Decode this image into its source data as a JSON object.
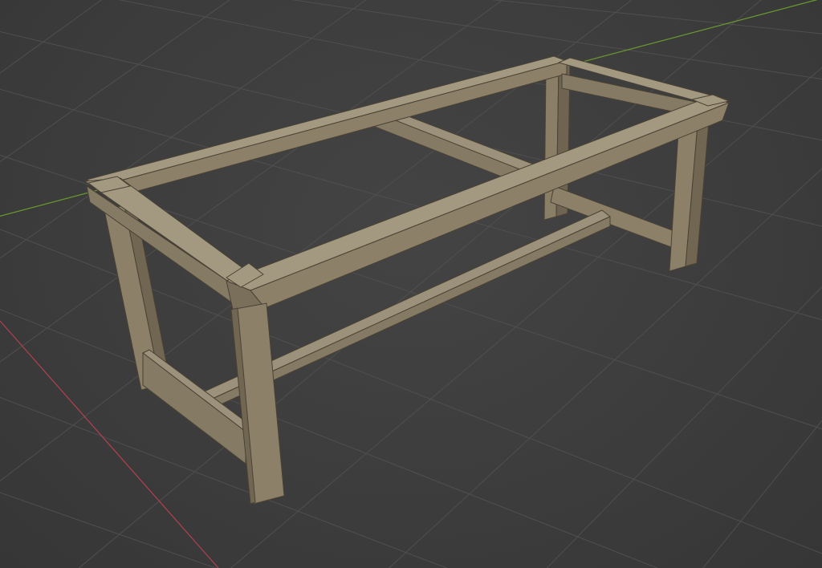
{
  "app": {
    "name": "3D viewport",
    "view": "perspective"
  },
  "scene": {
    "object": "table-frame",
    "material_colors": {
      "top": "#a39880",
      "front": "#8c8069",
      "side": "#7a6f5a",
      "dark": "#6c624f"
    },
    "grid_color": "#4f4f4f",
    "background": "#3d3d3d",
    "x_axis_color": "#b3414f",
    "y_axis_color": "#6a9a2e"
  }
}
